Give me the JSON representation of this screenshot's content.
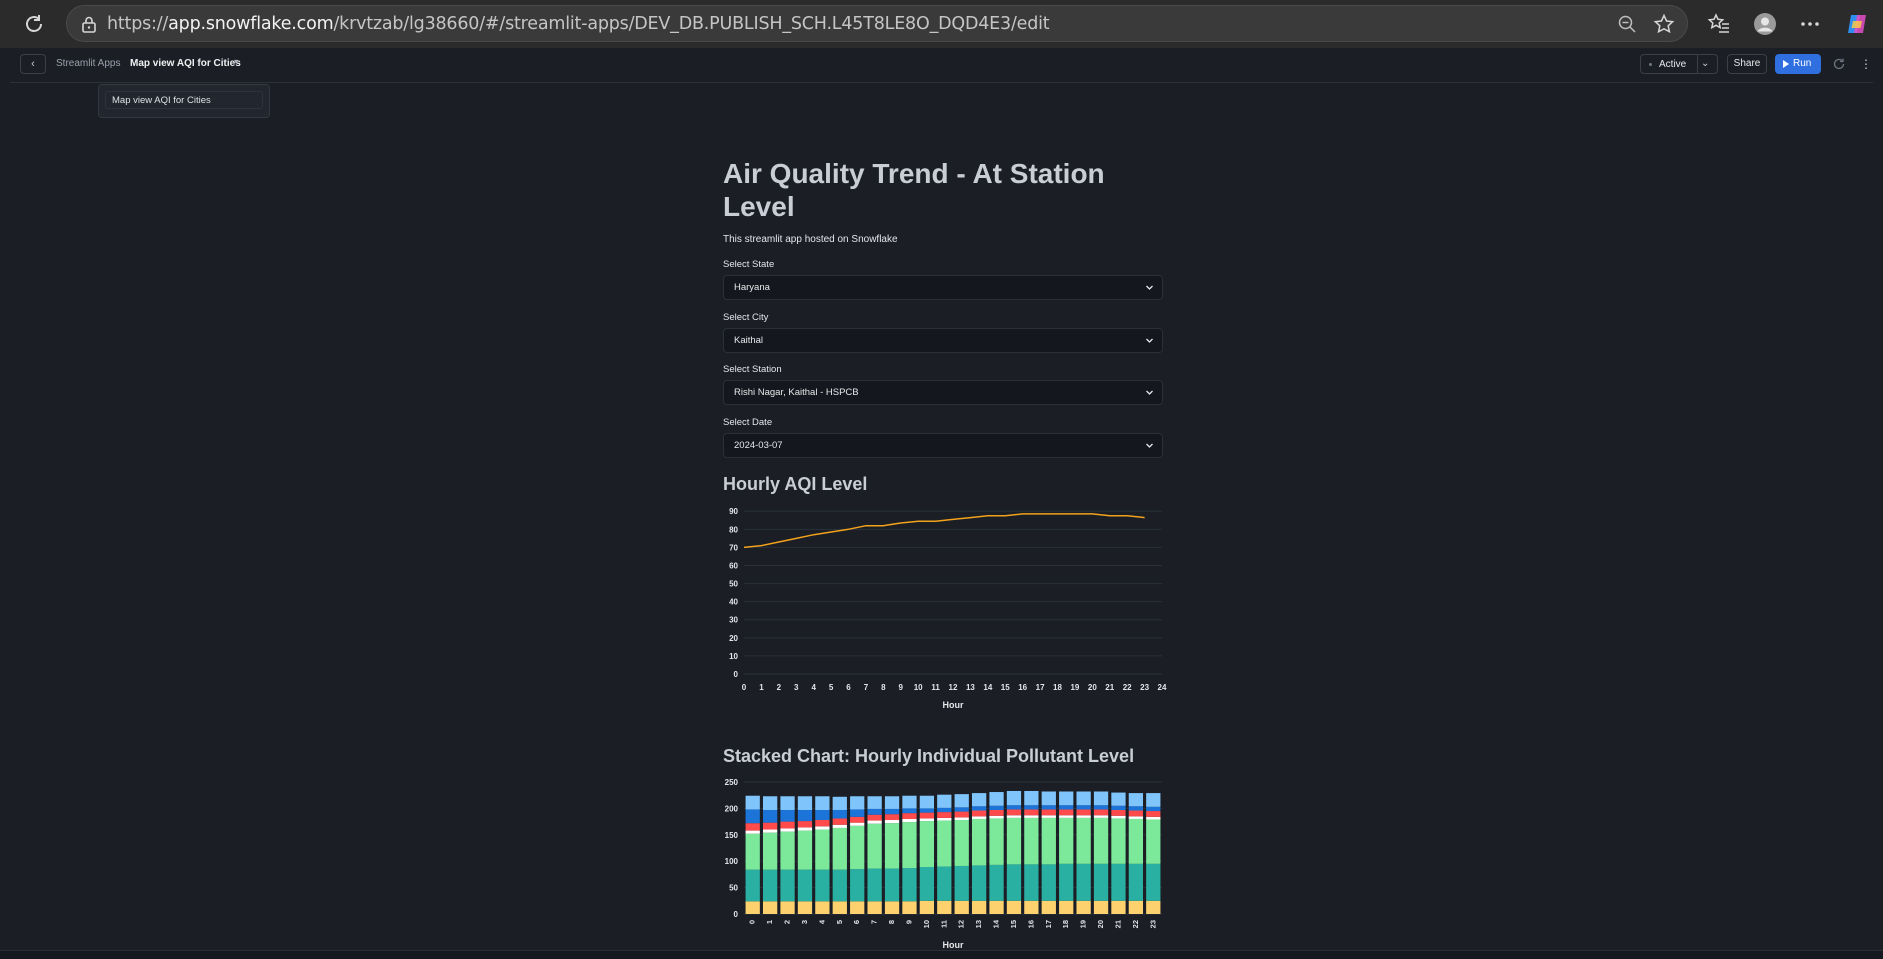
{
  "browser": {
    "url_domain": "app.snowflake.com",
    "url_path": "/krvtzab/lg38660/#/streamlit-apps/DEV_DB.PUBLISH_SCH.L45T8LE8O_DQD4E3/edit"
  },
  "header": {
    "back_label": "‹",
    "breadcrumb_root": "Streamlit Apps",
    "breadcrumb_current": "Map view AQI for Cities",
    "status_label": "Active",
    "share_label": "Share",
    "run_label": "Run",
    "dropdown_item": "Map view AQI for Cities"
  },
  "main": {
    "title": "Air Quality Trend - At Station Level",
    "caption": "This streamlit app hosted on Snowflake",
    "fields": [
      {
        "label": "Select State",
        "value": "Haryana"
      },
      {
        "label": "Select City",
        "value": "Kaithal"
      },
      {
        "label": "Select Station",
        "value": "Rishi Nagar, Kaithal - HSPCB"
      },
      {
        "label": "Select Date",
        "value": "2024-03-07"
      }
    ],
    "chart1_heading": "Hourly AQI Level",
    "chart2_heading": "Stacked Chart: Hourly Individual Pollutant Level"
  },
  "colors": {
    "line": "#f3a21b",
    "stack": [
      "#fdd26e",
      "#2ab0a3",
      "#7ce99a",
      "#ffffff",
      "#ff4b4b",
      "#1c74d9",
      "#7fc4fb"
    ]
  },
  "chart_data": [
    {
      "type": "line",
      "title": "",
      "xlabel": "Hour",
      "ylabel": "",
      "x": [
        0,
        1,
        2,
        3,
        4,
        5,
        6,
        7,
        8,
        9,
        10,
        11,
        12,
        13,
        14,
        15,
        16,
        17,
        18,
        19,
        20,
        21,
        22,
        23
      ],
      "y": [
        70,
        71,
        73,
        75,
        77,
        78.5,
        80,
        82,
        82,
        83.5,
        84.5,
        84.5,
        85.5,
        86.5,
        87.5,
        87.5,
        88.5,
        88.5,
        88.5,
        88.5,
        88.5,
        87.5,
        87.5,
        86.5
      ],
      "xticks": [
        0,
        1,
        2,
        3,
        4,
        5,
        6,
        7,
        8,
        9,
        10,
        11,
        12,
        13,
        14,
        15,
        16,
        17,
        18,
        19,
        20,
        21,
        22,
        23,
        24
      ],
      "yticks": [
        0,
        10,
        20,
        30,
        40,
        50,
        60,
        70,
        80,
        90
      ],
      "xlim": [
        0,
        24
      ],
      "ylim": [
        0,
        94
      ],
      "grid": true
    },
    {
      "type": "bar",
      "stacked": true,
      "title": "",
      "xlabel": "Hour",
      "ylabel": "",
      "categories": [
        "0",
        "1",
        "2",
        "3",
        "4",
        "5",
        "6",
        "7",
        "8",
        "9",
        "10",
        "11",
        "12",
        "13",
        "14",
        "15",
        "16",
        "17",
        "18",
        "19",
        "20",
        "21",
        "22",
        "23"
      ],
      "yticks": [
        0,
        50,
        100,
        150,
        200,
        250
      ],
      "ylim": [
        0,
        250
      ],
      "series": [
        {
          "values": [
            24,
            24,
            24,
            24,
            24,
            24,
            24,
            24,
            24,
            24,
            25,
            25,
            25,
            25,
            25,
            25,
            25,
            25,
            25,
            25,
            25,
            25,
            25,
            25
          ]
        },
        {
          "values": [
            60,
            60,
            60,
            60,
            60,
            60,
            61,
            62,
            62,
            63,
            64,
            65,
            66,
            67,
            68,
            69,
            69,
            69,
            70,
            70,
            70,
            70,
            70,
            70
          ]
        },
        {
          "values": [
            68,
            70,
            72,
            74,
            76,
            79,
            82,
            85,
            86,
            87,
            87,
            87,
            87,
            88,
            88,
            88,
            88,
            88,
            87,
            87,
            87,
            86,
            85,
            84
          ]
        },
        {
          "values": [
            6,
            6,
            6,
            6,
            6,
            6,
            6,
            6,
            6,
            6,
            5,
            5,
            5,
            5,
            5,
            5,
            5,
            5,
            5,
            5,
            5,
            5,
            5,
            5
          ]
        },
        {
          "values": [
            14,
            13,
            13,
            12,
            12,
            12,
            11,
            11,
            11,
            11,
            11,
            11,
            11,
            11,
            11,
            11,
            11,
            11,
            11,
            11,
            11,
            11,
            11,
            11
          ]
        },
        {
          "values": [
            26,
            24,
            22,
            21,
            19,
            16,
            14,
            11,
            10,
            9,
            8,
            8,
            8,
            8,
            8,
            8,
            8,
            8,
            8,
            8,
            8,
            8,
            8,
            8
          ]
        },
        {
          "values": [
            26,
            26,
            26,
            26,
            26,
            25,
            25,
            24,
            24,
            24,
            24,
            25,
            25,
            25,
            26,
            27,
            27,
            26,
            26,
            26,
            26,
            25,
            25,
            26
          ]
        }
      ]
    }
  ]
}
